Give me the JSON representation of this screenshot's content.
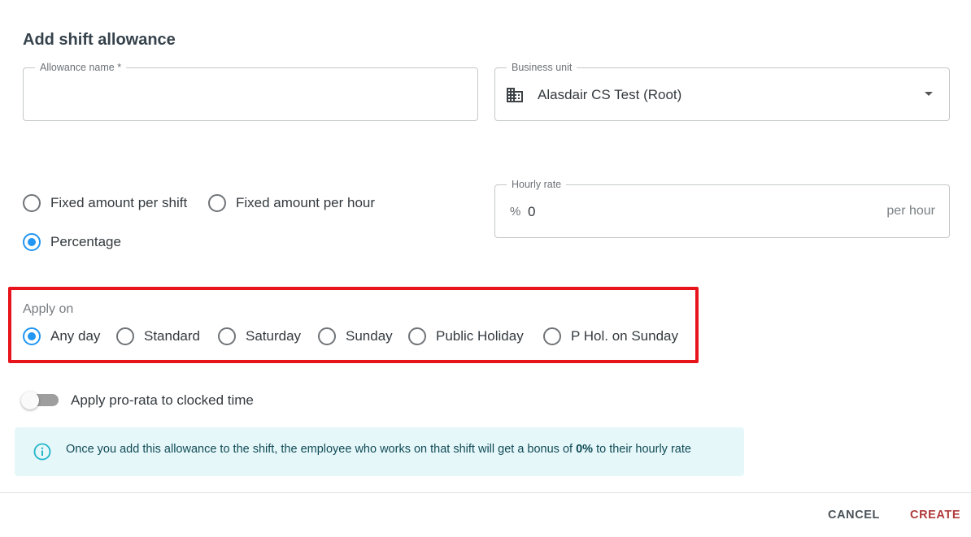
{
  "title": "Add shift allowance",
  "allowance_name": {
    "label": "Allowance name *",
    "value": ""
  },
  "business_unit": {
    "label": "Business unit",
    "value": "Alasdair CS Test (Root)",
    "icon": "building-icon"
  },
  "amount_type": {
    "options": [
      "Fixed amount per shift",
      "Fixed amount per hour",
      "Percentage"
    ],
    "selected": "Percentage"
  },
  "hourly_rate": {
    "label": "Hourly rate",
    "prefix": "%",
    "value": "0",
    "suffix": "per hour"
  },
  "apply_on": {
    "label": "Apply on",
    "options": [
      "Any day",
      "Standard",
      "Saturday",
      "Sunday",
      "Public Holiday",
      "P Hol. on Sunday"
    ],
    "selected": "Any day"
  },
  "pro_rata": {
    "label": "Apply pro-rata to clocked time",
    "enabled": false
  },
  "info": {
    "text_before": "Once you add this allowance to the shift, the employee who works on that shift will get a bonus of ",
    "bonus": "0%",
    "text_after": " to their hourly rate",
    "icon": "info-icon"
  },
  "actions": {
    "cancel": "CANCEL",
    "create": "CREATE"
  },
  "colors": {
    "accent": "#2196f3",
    "highlight": "#e8141c",
    "create": "#b03a3a",
    "info_bg": "#e6f7fa"
  }
}
